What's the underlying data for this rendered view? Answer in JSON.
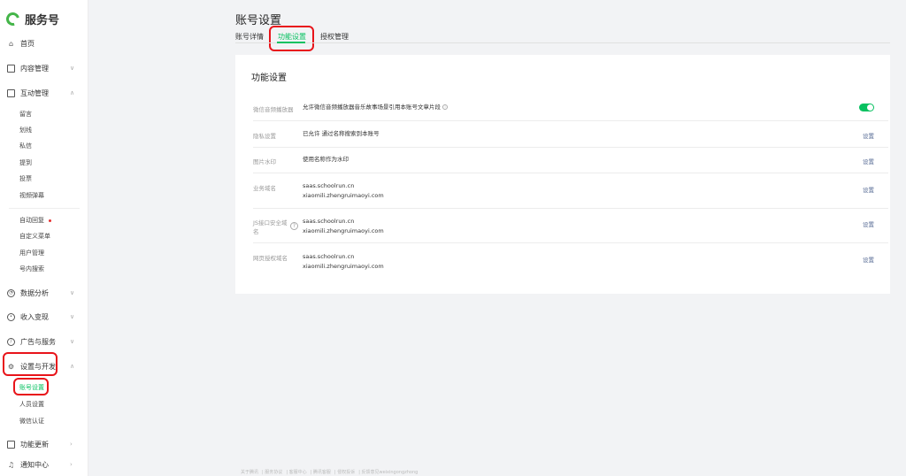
{
  "brand": {
    "name": "服务号",
    "color": "#44b549"
  },
  "accent": "#07c160",
  "sidebar": {
    "home": {
      "label": "首页",
      "icon": "home-icon"
    },
    "content": {
      "label": "内容管理",
      "icon": "document-icon"
    },
    "interaction": {
      "label": "互动管理",
      "icon": "chat-icon",
      "items": [
        "留言",
        "划线",
        "私信",
        "提到",
        "投票",
        "视频弹幕"
      ]
    },
    "auto_reply": "自动回复",
    "custom_menu": "自定义菜单",
    "user_mgmt": "用户管理",
    "search": "号内搜索",
    "analytics": {
      "label": "数据分析",
      "icon": "chart-icon"
    },
    "income": {
      "label": "收入变现",
      "icon": "coin-icon"
    },
    "ads": {
      "label": "广告与服务",
      "icon": "compass-icon"
    },
    "settings": {
      "label": "设置与开发",
      "icon": "gear-icon",
      "items": [
        "账号设置",
        "人员设置",
        "微信认证"
      ]
    },
    "updates": {
      "label": "功能更新",
      "icon": "update-icon"
    },
    "notices": {
      "label": "通知中心",
      "icon": "bell-icon"
    }
  },
  "page": {
    "title": "账号设置",
    "tabs": [
      "账号详情",
      "功能设置",
      "授权管理"
    ]
  },
  "card": {
    "title": "功能设置",
    "rows": [
      {
        "label": "微信音频播放器",
        "value": "允许微信音频播放器音乐故事场景引用本账号文章片段",
        "action": ""
      },
      {
        "label": "隐私设置",
        "value": "已允许 通过名称搜索到本账号",
        "action": "设置"
      },
      {
        "label": "图片水印",
        "value": "使用名称作为水印",
        "action": "设置"
      },
      {
        "label": "业务域名",
        "value1": "saas.schoolrun.cn",
        "value2": "xiaomili.zhengruimaoyi.com",
        "action": "设置"
      },
      {
        "label": "JS接口安全域名",
        "label1": "JS接口安全域",
        "label2": "名",
        "value1": "saas.schoolrun.cn",
        "value2": "xiaomili.zhengruimaoyi.com",
        "action": "设置"
      },
      {
        "label": "网页授权域名",
        "value1": "saas.schoolrun.cn",
        "value2": "xiaomili.zhengruimaoyi.com",
        "action": "设置"
      }
    ],
    "audio_player_enabled": true
  },
  "footer": [
    "关于腾讯",
    "服务协议",
    "客服中心",
    "腾讯客服",
    "侵权投诉",
    "反馈意见weixingongzhong"
  ]
}
